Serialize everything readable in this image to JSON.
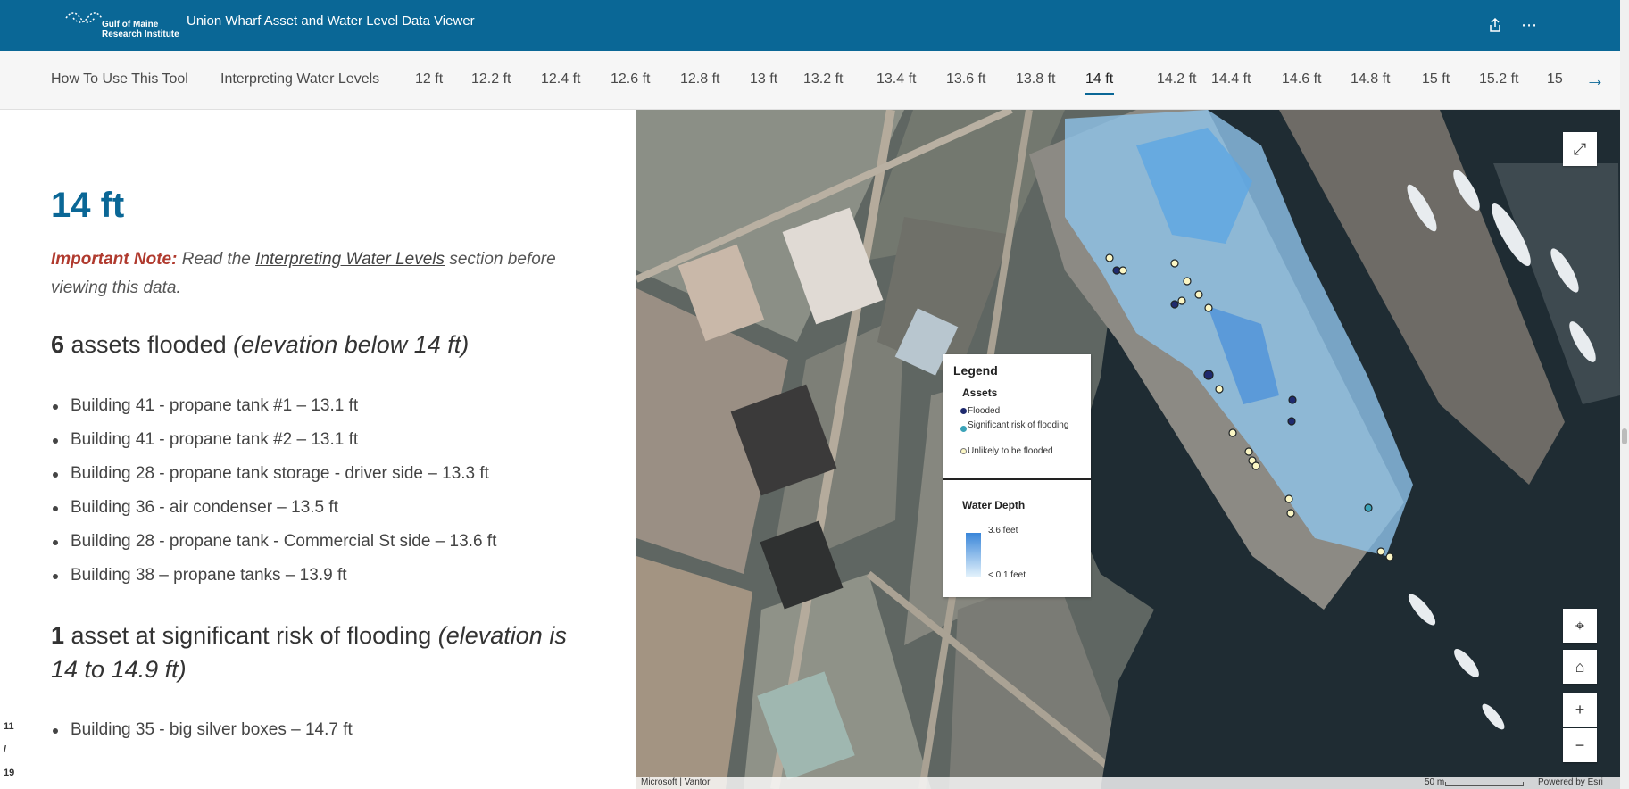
{
  "header": {
    "logo_line1": "Gulf of Maine",
    "logo_line2": "Research Institute",
    "title": "Union Wharf Asset and Water Level Data Viewer",
    "share_icon": "share-icon",
    "more_icon": "more-icon"
  },
  "nav": {
    "items": [
      "How To Use This Tool",
      "Interpreting Water Levels",
      "12 ft",
      "12.2 ft",
      "12.4 ft",
      "12.6 ft",
      "12.8 ft",
      "13 ft",
      "13.2 ft",
      "13.4 ft",
      "13.6 ft",
      "13.8 ft",
      "14 ft",
      "14.2 ft",
      "14.4 ft",
      "14.6 ft",
      "14.8 ft",
      "15 ft",
      "15.2 ft",
      "15"
    ],
    "active": "14 ft",
    "next_arrow": "→"
  },
  "content": {
    "heading": "14 ft",
    "note_label": "Important Note:",
    "note_pre": " Read the ",
    "note_link": "Interpreting Water Levels",
    "note_post": " section before viewing this data.",
    "flooded_count": "6",
    "flooded_text": " assets flooded ",
    "flooded_paren": "(elevation below 14 ft)",
    "flooded_items": [
      "Building 41 - propane tank #1 – 13.1 ft",
      "Building 41 - propane tank #2 – 13.1 ft",
      "Building 28 - propane tank storage - driver side – 13.3 ft",
      "Building 36 - air condenser – 13.5 ft",
      "Building 28 - propane tank - Commercial St side – 13.6 ft",
      "Building 38 – propane tanks – 13.9 ft"
    ],
    "risk_count": "1",
    "risk_text": " asset at significant risk of flooding ",
    "risk_paren": "(elevation is 14 to 14.9 ft)",
    "risk_items": [
      "Building 35 - big silver boxes – 14.7 ft"
    ]
  },
  "pager": {
    "current": "11",
    "sep": "/",
    "total": "19"
  },
  "legend": {
    "title": "Legend",
    "assets_title": "Assets",
    "flooded": "Flooded",
    "risk": "Significant risk of flooding",
    "unlikely": "Unlikely to be flooded",
    "depth_title": "Water Depth",
    "depth_max": "3.6 feet",
    "depth_min": "< 0.1 feet",
    "colors": {
      "flooded": "#1f2a6e",
      "risk": "#3ba3b8",
      "unlikely": "#fbf6c4"
    }
  },
  "map": {
    "expand_icon": "expand-icon",
    "locate_icon": "locate-icon",
    "home_icon": "home-icon",
    "zoom_in": "+",
    "zoom_out": "−",
    "attribution": "Microsoft | Vantor",
    "scale": "50 m",
    "powered": "Powered by Esri"
  },
  "colors": {
    "header": "#0a6796",
    "accent": "#0a6796",
    "important": "#b03a2e"
  }
}
